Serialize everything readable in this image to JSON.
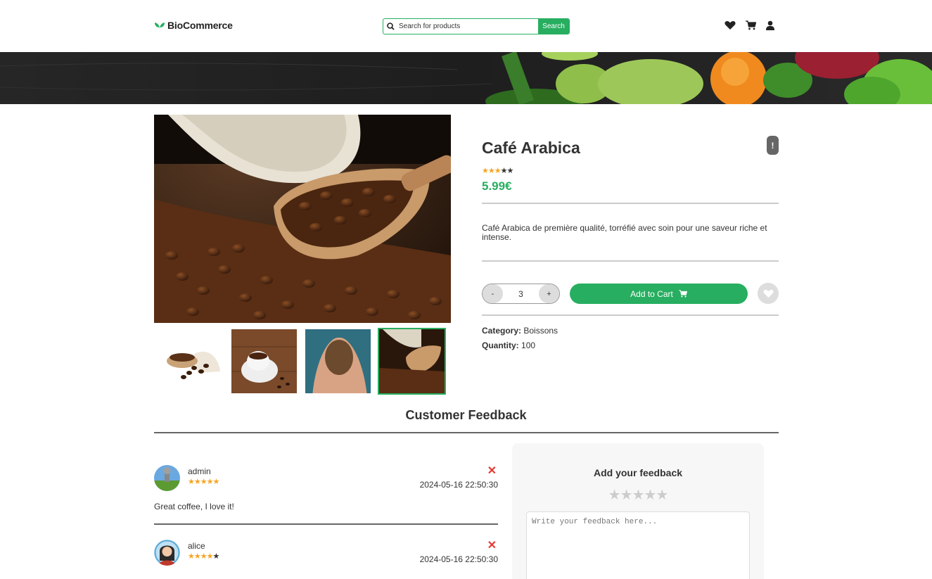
{
  "header": {
    "brand": "BioCommerce",
    "search_placeholder": "Search for products",
    "search_button": "Search",
    "icons": [
      "heart-icon",
      "cart-icon",
      "user-icon"
    ]
  },
  "product": {
    "title": "Café Arabica",
    "rating": 3,
    "rating_max": 5,
    "price": "5.99€",
    "description": "Café Arabica de première qualité, torréfié avec soin pour une saveur riche et intense.",
    "quantity_selected": "3",
    "qty_minus": "-",
    "qty_plus": "+",
    "add_to_cart": "Add to Cart",
    "category_label": "Category:",
    "category_value": "Boissons",
    "quantity_label": "Quantity:",
    "quantity_value": "100",
    "report_icon": "!"
  },
  "feedback": {
    "section_title": "Customer Feedback",
    "reviews": [
      {
        "user": "admin",
        "rating": 5,
        "date": "2024-05-16 22:50:30",
        "text": "Great coffee, I love it!"
      },
      {
        "user": "alice",
        "rating": 4,
        "date": "2024-05-16 22:50:30",
        "text": ""
      }
    ],
    "form": {
      "title": "Add your feedback",
      "placeholder": "Write your feedback here..."
    }
  },
  "colors": {
    "accent": "#27ae60",
    "star": "#f5a623",
    "delete": "#e53935"
  }
}
